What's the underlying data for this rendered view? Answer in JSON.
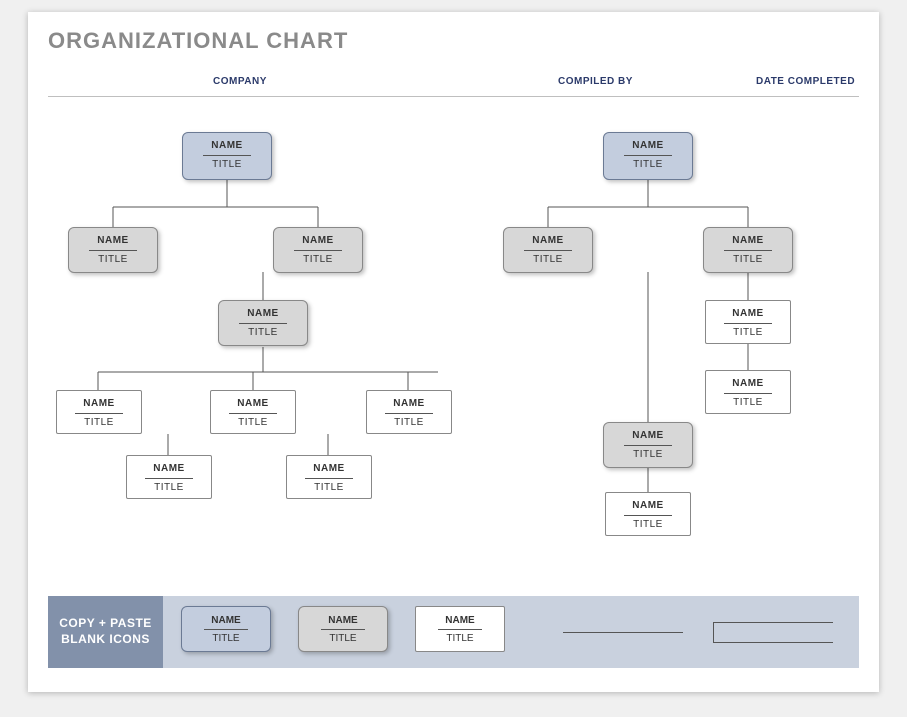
{
  "title": "ORGANIZATIONAL CHART",
  "headers": {
    "company": "COMPANY",
    "compiled_by": "COMPILED BY",
    "date_completed": "DATE COMPLETED"
  },
  "labels": {
    "name": "NAME",
    "title": "TITLE"
  },
  "footer": {
    "label_line1": "COPY + PASTE",
    "label_line2": "BLANK ICONS"
  },
  "chart_data": {
    "type": "org-chart",
    "trees": [
      {
        "root": {
          "name": "NAME",
          "title": "TITLE",
          "style": "blue",
          "children": [
            {
              "name": "NAME",
              "title": "TITLE",
              "style": "grey"
            },
            {
              "name": "NAME",
              "title": "TITLE",
              "style": "grey",
              "children": [
                {
                  "name": "NAME",
                  "title": "TITLE",
                  "style": "white"
                },
                {
                  "name": "NAME",
                  "title": "TITLE",
                  "style": "white"
                },
                {
                  "name": "NAME",
                  "title": "TITLE",
                  "style": "white"
                },
                {
                  "name": "NAME",
                  "title": "TITLE",
                  "style": "white"
                },
                {
                  "name": "NAME",
                  "title": "TITLE",
                  "style": "white"
                }
              ]
            }
          ]
        }
      },
      {
        "root": {
          "name": "NAME",
          "title": "TITLE",
          "style": "blue",
          "children": [
            {
              "name": "NAME",
              "title": "TITLE",
              "style": "grey",
              "children": [
                {
                  "name": "NAME",
                  "title": "TITLE",
                  "style": "grey",
                  "children": [
                    {
                      "name": "NAME",
                      "title": "TITLE",
                      "style": "white"
                    }
                  ]
                }
              ]
            },
            {
              "name": "NAME",
              "title": "TITLE",
              "style": "grey",
              "children": [
                {
                  "name": "NAME",
                  "title": "TITLE",
                  "style": "white"
                },
                {
                  "name": "NAME",
                  "title": "TITLE",
                  "style": "white"
                }
              ]
            }
          ]
        }
      }
    ],
    "palette": {
      "blue": "#c3cdde",
      "grey": "#d7d7d7",
      "white": "#ffffff"
    }
  }
}
